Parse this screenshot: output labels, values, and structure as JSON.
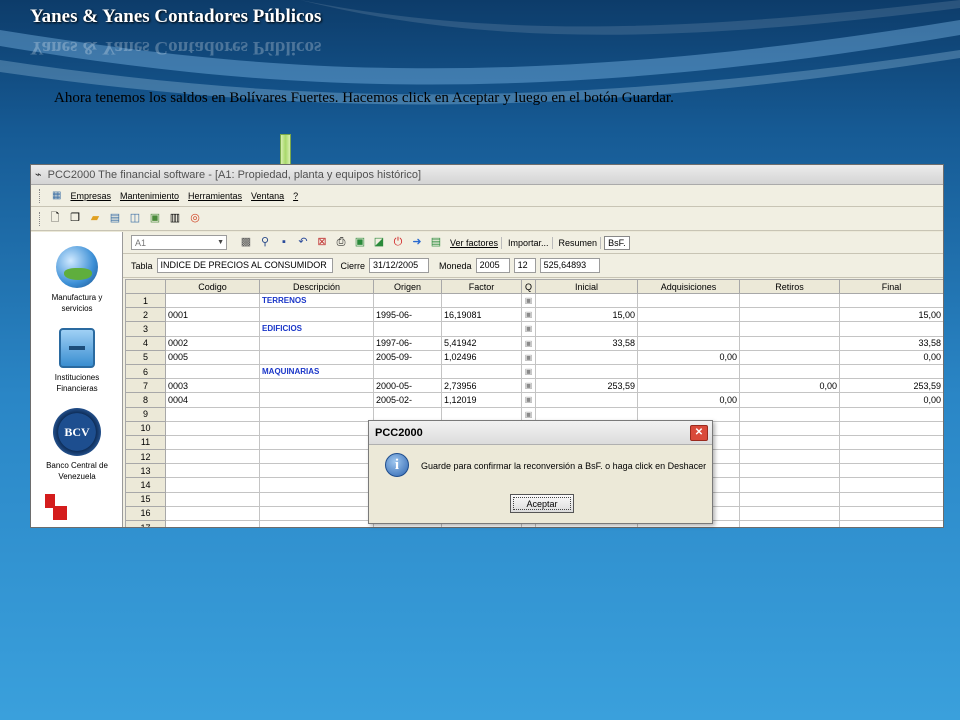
{
  "slide": {
    "title": "Yanes & Yanes Contadores Públicos",
    "caption": "Ahora tenemos los saldos en Bolívares Fuertes. Hacemos click en Aceptar y luego en el botón Guardar."
  },
  "app": {
    "window_title": "PCC2000 The financial software - [A1: Propiedad, planta y equipos histórico]",
    "menu": [
      "Empresas",
      "Mantenimiento",
      "Herramientas",
      "Ventana",
      "?"
    ],
    "cell_ref": "A1",
    "toolbar_buttons": {
      "ver_factores": "Ver factores",
      "importar": "Importar...",
      "resumen": "Resumen",
      "bsf": "BsF."
    },
    "filter": {
      "tabla_label": "Tabla",
      "tabla_value": "INDICE DE PRECIOS AL CONSUMIDOR",
      "cierre_label": "Cierre",
      "cierre_value": "31/12/2005",
      "moneda_label": "Moneda",
      "moneda_year": "2005",
      "moneda_month": "12",
      "moneda_value": "525,64893"
    },
    "sidebar": [
      {
        "label_1": "Manufactura y",
        "label_2": "servicios",
        "icon": "globe-people-icon"
      },
      {
        "label_1": "Instituciones",
        "label_2": "Financieras",
        "icon": "cabinet-icon"
      },
      {
        "label_1": "Banco Central de",
        "label_2": "Venezuela",
        "icon": "bcv-seal-icon",
        "seal_text": "BCV"
      }
    ],
    "table": {
      "headers": [
        "Codigo",
        "Descripción",
        "Origen",
        "Factor",
        "Q",
        "Inicial",
        "Adquisiciones",
        "Retiros",
        "Final"
      ],
      "rows": [
        {
          "n": "1",
          "codigo": "",
          "desc": "TERRENOS",
          "origen": "",
          "factor": "",
          "inicial": "",
          "adq": "",
          "ret": "",
          "final": ""
        },
        {
          "n": "2",
          "codigo": "0001",
          "desc": "",
          "origen": "1995-06-",
          "factor": "16,19081",
          "inicial": "15,00",
          "adq": "",
          "ret": "",
          "final": "15,00"
        },
        {
          "n": "3",
          "codigo": "",
          "desc": "EDIFICIOS",
          "origen": "",
          "factor": "",
          "inicial": "",
          "adq": "",
          "ret": "",
          "final": ""
        },
        {
          "n": "4",
          "codigo": "0002",
          "desc": "",
          "origen": "1997-06-",
          "factor": "5,41942",
          "inicial": "33,58",
          "adq": "",
          "ret": "",
          "final": "33,58"
        },
        {
          "n": "5",
          "codigo": "0005",
          "desc": "",
          "origen": "2005-09-",
          "factor": "1,02496",
          "inicial": "",
          "adq": "0,00",
          "ret": "",
          "final": "0,00"
        },
        {
          "n": "6",
          "codigo": "",
          "desc": "MAQUINARIAS",
          "origen": "",
          "factor": "",
          "inicial": "",
          "adq": "",
          "ret": "",
          "final": ""
        },
        {
          "n": "7",
          "codigo": "0003",
          "desc": "",
          "origen": "2000-05-",
          "factor": "2,73956",
          "inicial": "253,59",
          "adq": "",
          "ret": "0,00",
          "final": "253,59"
        },
        {
          "n": "8",
          "codigo": "0004",
          "desc": "",
          "origen": "2005-02-",
          "factor": "1,12019",
          "inicial": "",
          "adq": "0,00",
          "ret": "",
          "final": "0,00"
        },
        {
          "n": "9"
        },
        {
          "n": "10"
        },
        {
          "n": "11"
        },
        {
          "n": "12"
        },
        {
          "n": "13"
        },
        {
          "n": "14"
        },
        {
          "n": "15"
        },
        {
          "n": "16"
        },
        {
          "n": "17"
        }
      ]
    }
  },
  "dialog": {
    "title": "PCC2000",
    "message": "Guarde para confirmar la reconversión a BsF. o haga click en Deshacer",
    "ok_label": "Aceptar",
    "close_glyph": "✕",
    "info_glyph": "i"
  },
  "colors": {
    "background_top": "#0d3c6a",
    "background_bottom": "#3aa0dc",
    "section_text": "#1a36c8",
    "arrow": "#a8d86a"
  }
}
